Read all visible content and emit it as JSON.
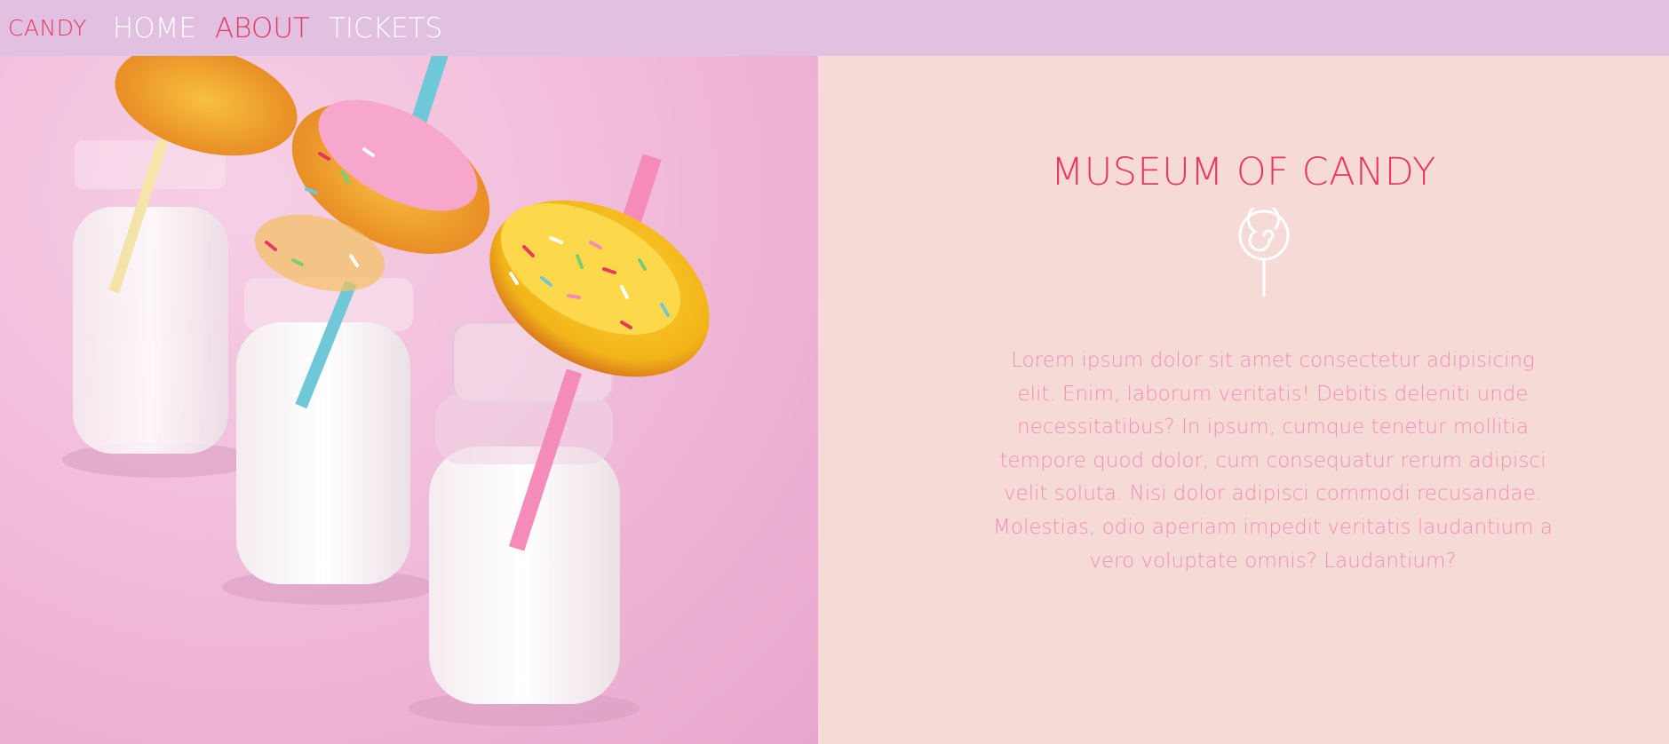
{
  "nav": {
    "brand": "CANDY",
    "links": [
      "HOME",
      "ABOUT",
      "TICKETS"
    ],
    "active_link": "ABOUT"
  },
  "hero": {
    "image_description_icon": "donuts-on-milk-bottles-photo"
  },
  "content": {
    "title": "MUSEUM OF CANDY",
    "icon": "lollipop-icon",
    "body": "Lorem ipsum dolor sit amet consectetur adipisicing elit. Enim, laborum veritatis! Debitis deleniti unde necessitatibus? In ipsum, cumque tenetur mollitia tempore quod dolor, cum consequatur rerum adipisci velit soluta. Nisi dolor adipisci commodi recusandae. Molestias, odio aperiam impedit veritatis laudantium a vero voluptate omnis? Laudantium?"
  },
  "colors": {
    "navbar_bg": "#e1c0e1",
    "accent": "#e8385e",
    "panel_bg": "#f6dad6",
    "body_text": "#f18fba",
    "hero_pink": "#f0b8d8"
  }
}
